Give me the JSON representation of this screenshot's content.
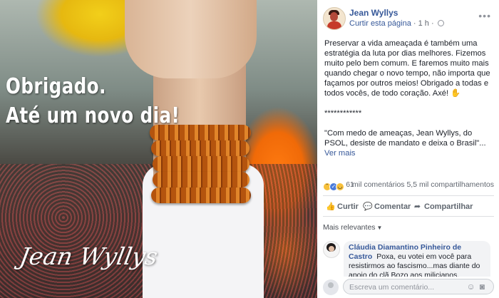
{
  "image": {
    "overlay_line1": "Obrigado.",
    "overlay_line2": "Até um novo dia!",
    "signature": "Jean Wyllys"
  },
  "post": {
    "page_name": "Jean Wyllys",
    "like_page": "Curtir esta página",
    "separator": "·",
    "time": "1 h",
    "paragraph1": "Preservar a vida ameaçada é também uma estratégia da luta por dias melhores. Fizemos muito pelo bem comum. E faremos muito mais quando chegar o novo tempo, não importa que façamos por outros meios! Obrigado a todas e todos vocês, de todo coração. Axé!",
    "hand_emoji": "✋",
    "stars": "************",
    "quote": "\"Com medo de ameaças, Jean Wyllys, do PSOL, desiste de mandato e deixa o Brasil\"...",
    "see_more": "Ver mais"
  },
  "reactions": {
    "count": "1",
    "stats": "6 mil comentários   5,5 mil compartilhamentos"
  },
  "actions": {
    "like": "Curtir",
    "comment": "Comentar",
    "share": "Compartilhar"
  },
  "comments": {
    "sort_label": "Mais relevantes",
    "first": {
      "author": "Cláudia Diamantino Pinheiro de Castro",
      "text": "Poxa, eu votei em você para resistirmos ao fascismo...mas diante do apoio do clã Bozo aos milicianos, entendo e apoio a sua"
    },
    "composer_placeholder": "Escreva um comentário..."
  },
  "colors": {
    "link": "#365899",
    "muted": "#616770"
  }
}
